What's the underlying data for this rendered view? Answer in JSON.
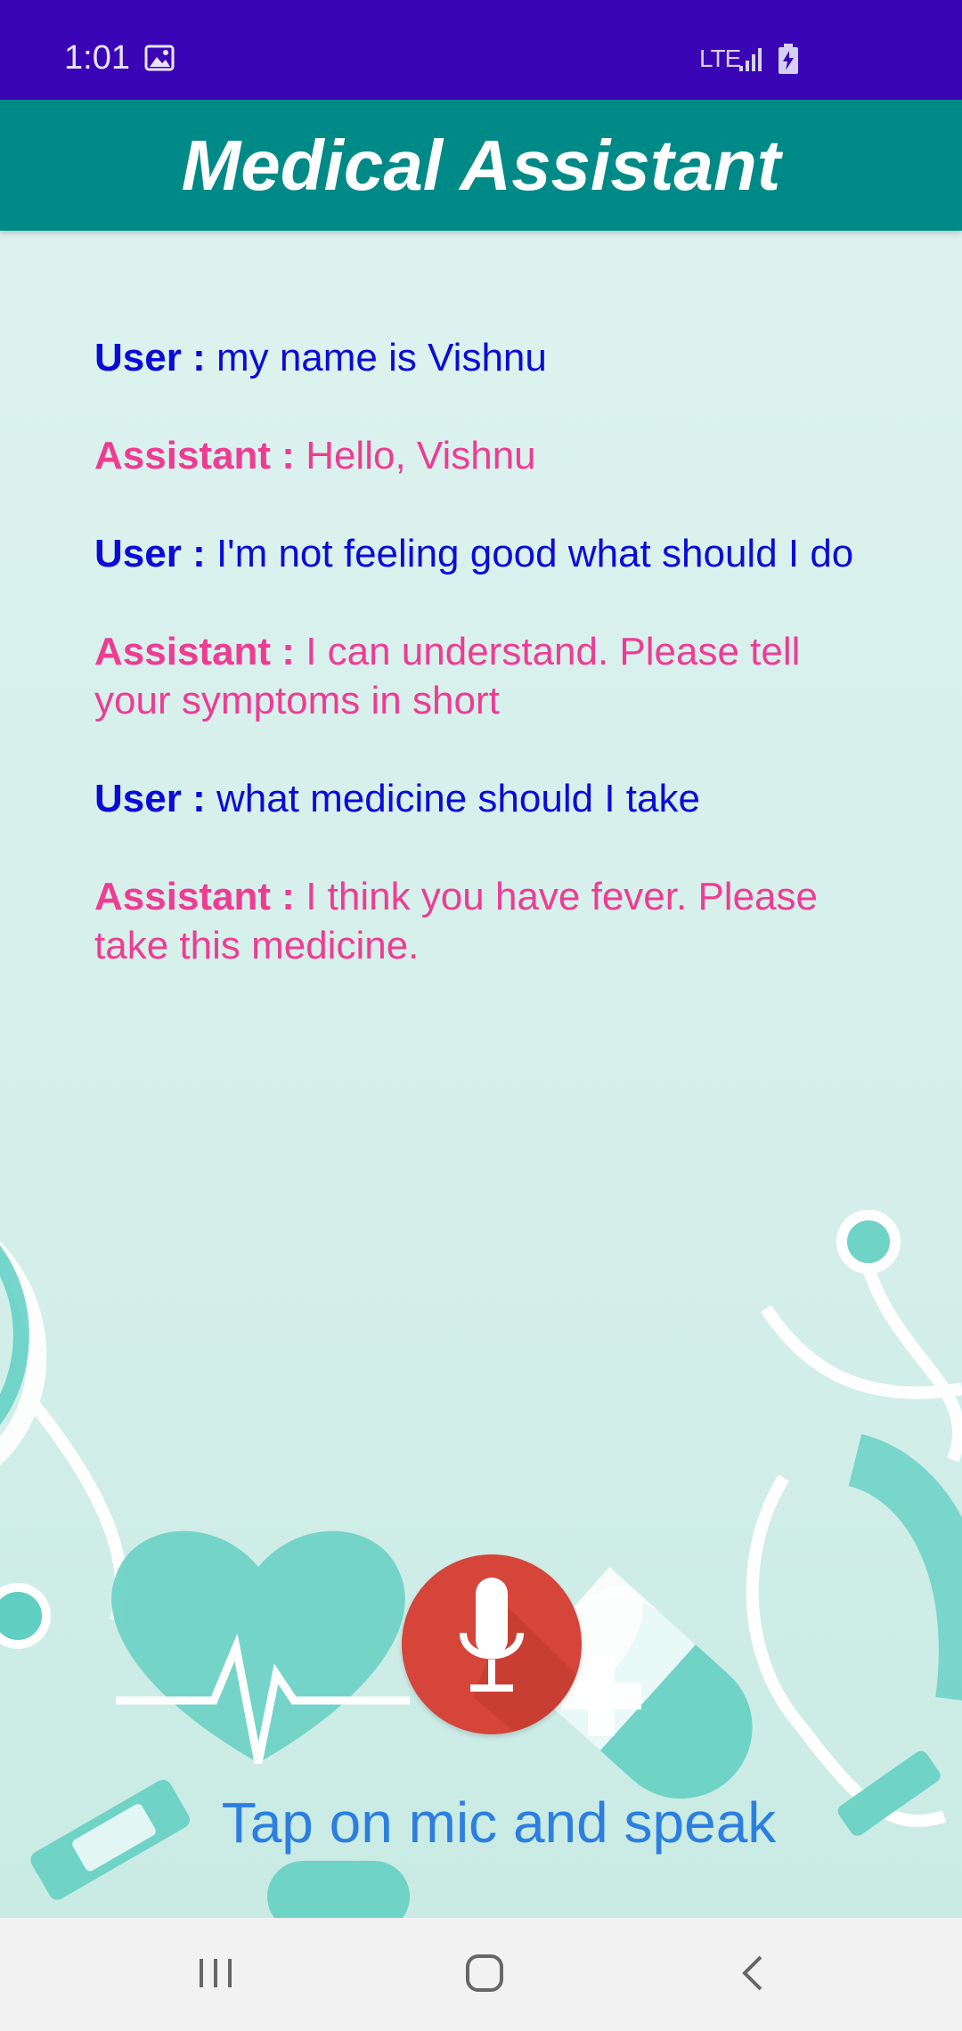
{
  "status_bar": {
    "time": "1:01",
    "network": "LTE",
    "icons": [
      "gallery-icon",
      "signal-icon",
      "battery-charging-icon"
    ]
  },
  "header": {
    "title": "Medical Assistant"
  },
  "conversation": [
    {
      "role": "user",
      "speaker": "User :",
      "text": "my name is Vishnu"
    },
    {
      "role": "assistant",
      "speaker": "Assistant :",
      "text": "Hello, Vishnu"
    },
    {
      "role": "user",
      "speaker": "User :",
      "text": "I'm not feeling good what should I do"
    },
    {
      "role": "assistant",
      "speaker": "Assistant :",
      "text": "I can understand. Please tell your symptoms in short"
    },
    {
      "role": "user",
      "speaker": "User :",
      "text": "what medicine should I take"
    },
    {
      "role": "assistant",
      "speaker": "Assistant :",
      "text": "I think you have fever. Please take this medicine."
    }
  ],
  "mic": {
    "icon": "microphone-icon",
    "hint": "Tap on mic and speak"
  },
  "nav_bar": {
    "icons": [
      "recents-icon",
      "home-icon",
      "back-icon"
    ]
  },
  "colors": {
    "status_bar": "#3a05b4",
    "header": "#008a87",
    "background": "#d9f1ec",
    "user_text": "#0b0bd8",
    "assistant_text": "#ee3c93",
    "mic_button": "#d6453a",
    "hint_text": "#2c7fe0"
  }
}
